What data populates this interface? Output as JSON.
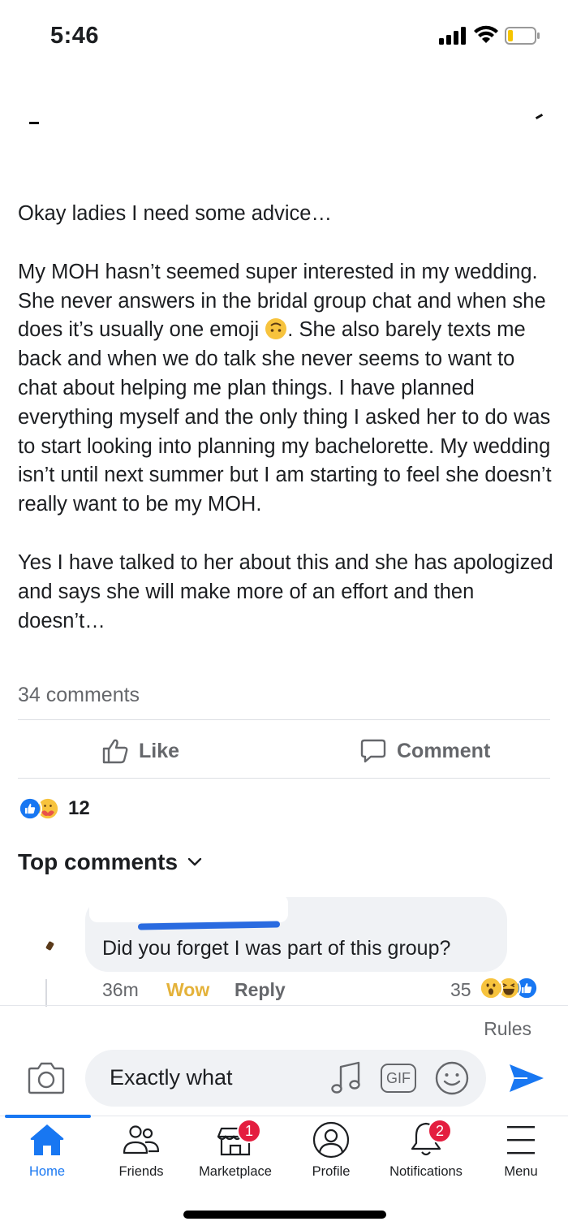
{
  "status_bar": {
    "time": "5:46"
  },
  "post": {
    "paragraphs": [
      "Okay ladies I need some advice…",
      "My MOH hasn’t seemed super interested in my wedding. She never answers in the bridal group chat and when she does it’s usually one emoji",
      ". She also barely texts me back and when we do talk she never seems to want to chat about helping me plan things. I have planned everything myself and the only thing I asked her to do was to start looking into planning my bachelorette. My wedding isn’t until next summer but I am starting to feel she doesn’t really want to be my MOH.",
      "Yes I have talked to her about this and she has apologized and says she will make more of an effort and then doesn’t…"
    ],
    "inline_emoji": "upside-down-face-icon",
    "comments_count": "34 comments",
    "reaction_count": "12",
    "reaction_icons": [
      "like-reaction-icon",
      "care-reaction-icon"
    ]
  },
  "actions": {
    "like_label": "Like",
    "comment_label": "Comment"
  },
  "top_comments": {
    "label": "Top comments"
  },
  "comment": {
    "text": "Did you forget I was part of this group?",
    "time": "36m",
    "reaction_label": "Wow",
    "reply_label": "Reply",
    "reaction_count": "35",
    "reaction_icons": [
      "wow-reaction-icon",
      "haha-reaction-icon",
      "like-reaction-icon"
    ]
  },
  "composer": {
    "rules_label": "Rules",
    "input_value": "Exactly what",
    "gif_label": "GIF"
  },
  "nav": {
    "items": [
      {
        "label": "Home",
        "icon": "home-icon",
        "active": true
      },
      {
        "label": "Friends",
        "icon": "friends-icon"
      },
      {
        "label": "Marketplace",
        "icon": "marketplace-icon",
        "badge": "1"
      },
      {
        "label": "Profile",
        "icon": "profile-icon"
      },
      {
        "label": "Notifications",
        "icon": "bell-icon",
        "badge": "2"
      },
      {
        "label": "Menu",
        "icon": "menu-icon"
      }
    ]
  },
  "colors": {
    "accent": "#1877f2",
    "badge": "#e41e3f",
    "wow": "#e4b23a",
    "muted_text": "#65676b"
  }
}
